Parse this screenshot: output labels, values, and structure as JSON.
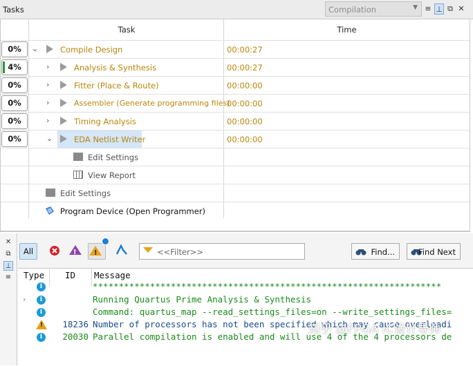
{
  "tasks_panel": {
    "title": "Tasks",
    "flow_value": "Compilation",
    "columns": {
      "task": "Task",
      "time": "Time"
    },
    "rows": [
      {
        "pct": "0%",
        "name": "Compile Design",
        "time": "00:00:27"
      },
      {
        "pct": "4%",
        "name": "Analysis & Synthesis",
        "time": "00:00:27",
        "progress": 0.04
      },
      {
        "pct": "0%",
        "name": "Fitter (Place & Route)",
        "time": "00:00:00"
      },
      {
        "pct": "0%",
        "name": "Assembler (Generate programming files)",
        "time": "00:00:00"
      },
      {
        "pct": "0%",
        "name": "Timing Analysis",
        "time": "00:00:00"
      },
      {
        "pct": "0%",
        "name": "EDA Netlist Writer",
        "time": "00:00:00"
      }
    ],
    "sub_items": {
      "edit_settings_child": "Edit Settings",
      "view_report": "View Report",
      "edit_settings": "Edit Settings",
      "program_device": "Program Device (Open Programmer)"
    }
  },
  "messages_panel": {
    "all_label": "All",
    "filter_placeholder": "<<Filter>>",
    "find_label": "Find...",
    "find_next_label": "Find Next",
    "columns": {
      "type": "Type",
      "id": "ID",
      "message": "Message"
    },
    "rows": [
      {
        "type": "info",
        "id": "",
        "text": "*******************************************************************"
      },
      {
        "type": "info",
        "id": "",
        "text": "Running Quartus Prime Analysis & Synthesis"
      },
      {
        "type": "info",
        "id": "",
        "text": "Command: quartus_map --read_settings_files=on --write_settings_files="
      },
      {
        "type": "warning",
        "id": "18236",
        "text": "Number of processors has not been specified which may cause overloadi"
      },
      {
        "type": "info",
        "id": "20030",
        "text": "Parallel compilation is enabled and will use 4 of the 4 processors de"
      }
    ]
  },
  "watermark": "知乎 @FPGA IC设计导师"
}
